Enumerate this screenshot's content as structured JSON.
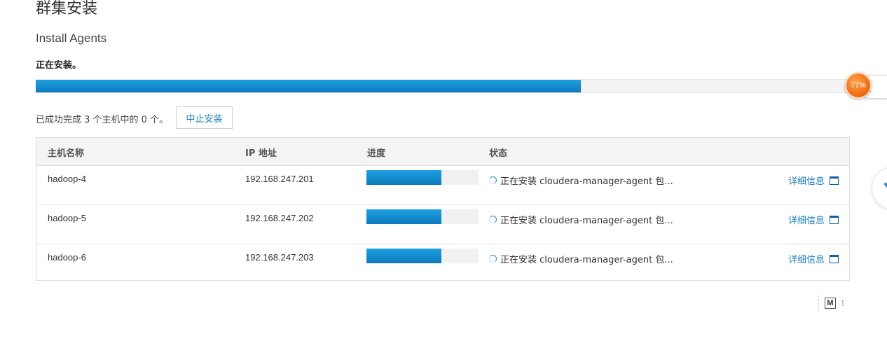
{
  "page": {
    "title": "群集安装",
    "subtitle": "Install Agents",
    "installing_label": "正在安装。"
  },
  "overall_progress": {
    "fraction": 0.64
  },
  "badge": {
    "percent_label": "77%",
    "up_arrow": "↑",
    "down_arrow": "↓"
  },
  "summary": {
    "text": "已成功完成 3 个主机中的 0 个。",
    "abort_button": "中止安装"
  },
  "table": {
    "headers": {
      "hostname": "主机名称",
      "ip": "IP 地址",
      "progress": "进度",
      "status": "状态"
    },
    "rows": [
      {
        "hostname": "hadoop-4",
        "ip": "192.168.247.201",
        "progress": 0.67,
        "status": "正在安装 cloudera-manager-agent 包...",
        "detail": "详细信息"
      },
      {
        "hostname": "hadoop-5",
        "ip": "192.168.247.202",
        "progress": 0.67,
        "status": "正在安装 cloudera-manager-agent 包...",
        "detail": "详细信息"
      },
      {
        "hostname": "hadoop-6",
        "ip": "192.168.247.203",
        "progress": 0.67,
        "status": "正在安装 cloudera-manager-agent 包...",
        "detail": "详细信息"
      }
    ]
  },
  "footer_widget": {
    "m_label": "M",
    "dots": "⁝"
  },
  "colors": {
    "accent_blue": "#1a7dc4",
    "progress_blue": "#0c79bd",
    "badge_orange": "#f26b0f"
  },
  "icons": {
    "spinner": "loading-spinner-icon",
    "detail_window": "window-icon"
  }
}
